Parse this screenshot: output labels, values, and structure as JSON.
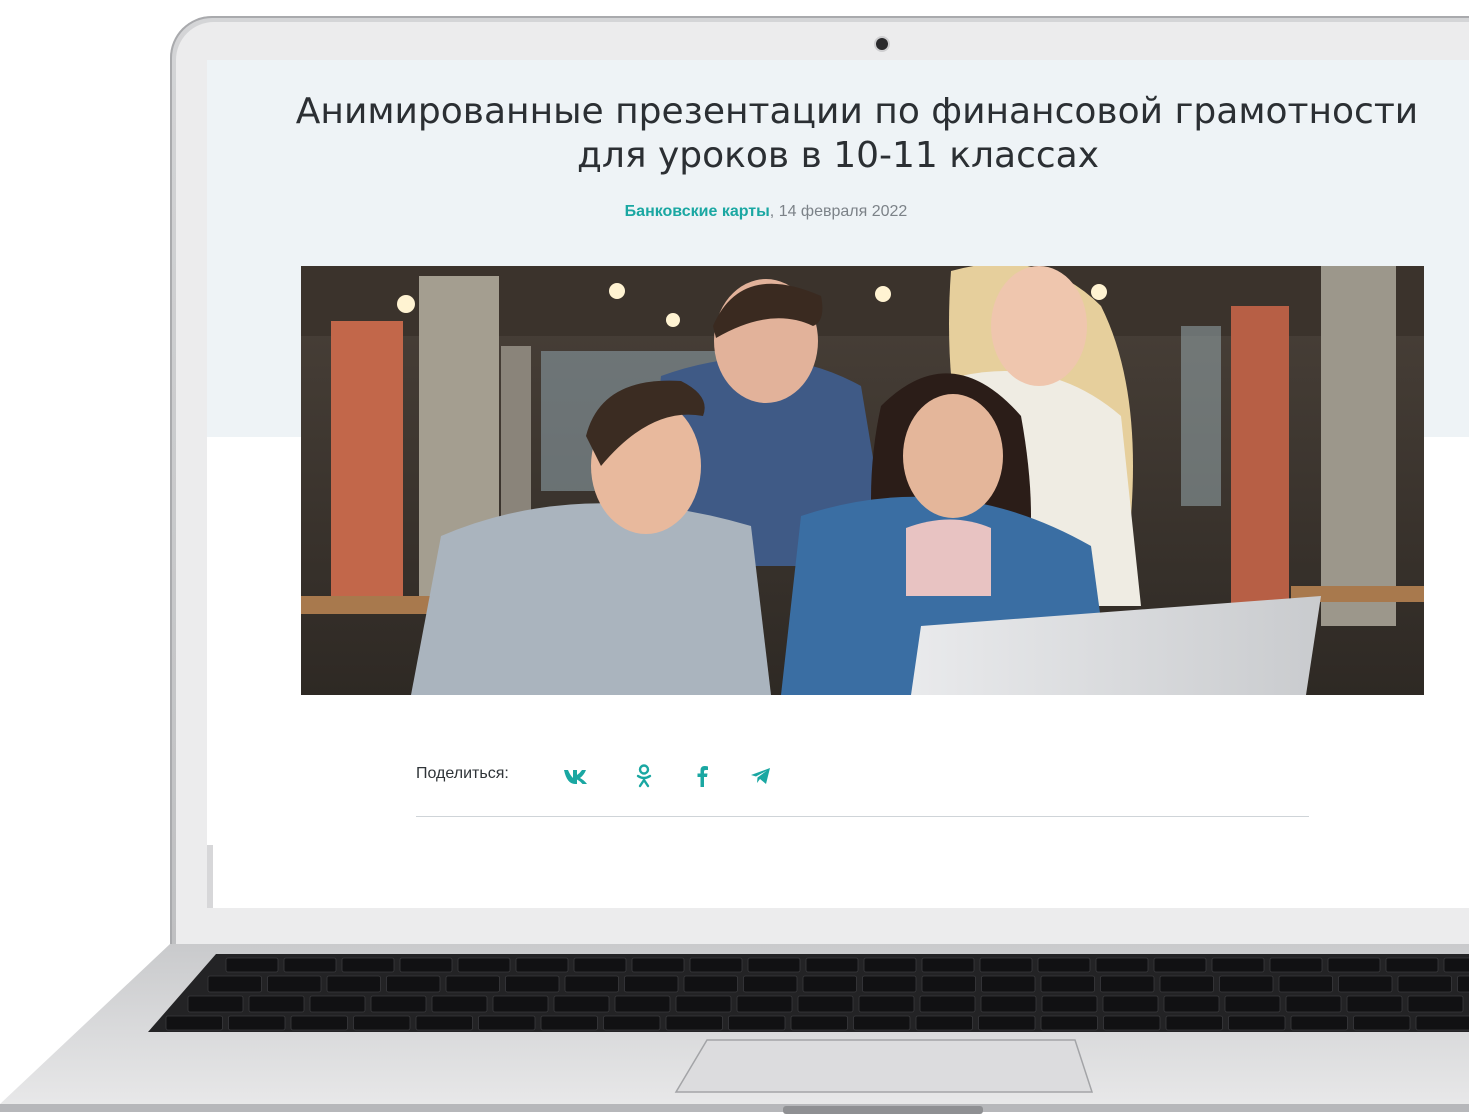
{
  "article": {
    "title_line1": "Анимированные презентации по финансовой грамотности",
    "title_line2": "для уроков в 10-11 классах",
    "category": "Банковские карты",
    "date": "14 февраля 2022",
    "hero_alt": "Четверо студентов смотрят в ноутбук"
  },
  "share": {
    "label": "Поделиться:",
    "networks": [
      {
        "name": "vk-icon",
        "glyph": "vk"
      },
      {
        "name": "odnoklassniki-icon",
        "glyph": "ok"
      },
      {
        "name": "facebook-icon",
        "glyph": "f"
      },
      {
        "name": "telegram-icon",
        "glyph": "tg"
      }
    ]
  },
  "colors": {
    "accent": "#1aa7a2",
    "title": "#2b2f33",
    "hero_band": "#eef3f6"
  }
}
